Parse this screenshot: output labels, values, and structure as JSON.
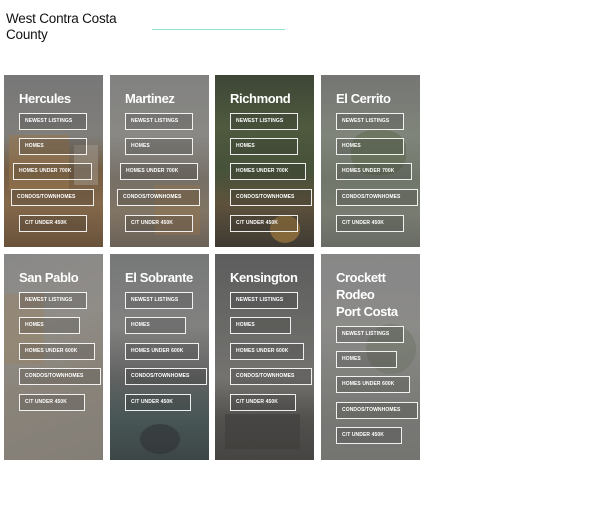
{
  "page": {
    "title": "West Contra Costa County"
  },
  "cards": [
    {
      "city": "Hercules",
      "buttons": [
        "NEWEST LISTINGS",
        "HOMES",
        "HOMES UNDER 700K",
        "CONDOS/TOWNHOMES",
        "C/T UNDER 450K"
      ]
    },
    {
      "city": "Martinez",
      "buttons": [
        "NEWEST LISTINGS",
        "HOMES",
        "HOMES UNDER 700K",
        "CONDOS/TOWNHOMES",
        "C/T UNDER 450K"
      ]
    },
    {
      "city": "Richmond",
      "buttons": [
        "NEWEST LISTINGS",
        "HOMES",
        "HOMES UNDER 700K",
        "CONDOS/TOWNHOMES",
        "C/T UNDER 450K"
      ]
    },
    {
      "city": "El Cerrito",
      "buttons": [
        "NEWEST LISTINGS",
        "HOMES",
        "HOMES UNDER 700K",
        "CONDOS/TOWNHOMES",
        "C/T UNDER 450K"
      ]
    },
    {
      "city": "San Pablo",
      "buttons": [
        "NEWEST LISTINGS",
        "HOMES",
        "HOMES UNDER 600K",
        "CONDOS/TOWNHOMES",
        "C/T UNDER 450K"
      ]
    },
    {
      "city": "El Sobrante",
      "buttons": [
        "NEWEST LISTINGS",
        "HOMES",
        "HOMES UNDER 600K",
        "CONDOS/TOWNHOMES",
        "C/T UNDER 450K"
      ]
    },
    {
      "city": "Kensington",
      "buttons": [
        "NEWEST LISTINGS",
        "HOMES",
        "HOMES UNDER 600K",
        "CONDOS/TOWNHOMES",
        "C/T UNDER 450K"
      ]
    },
    {
      "city": "Crockett\nRodeo\nPort Costa",
      "buttons": [
        "NEWEST LISTINGS",
        "HOMES",
        "HOMES UNDER 600K",
        "CONDOS/TOWNHOMES",
        "C/T UNDER 450K"
      ]
    }
  ]
}
